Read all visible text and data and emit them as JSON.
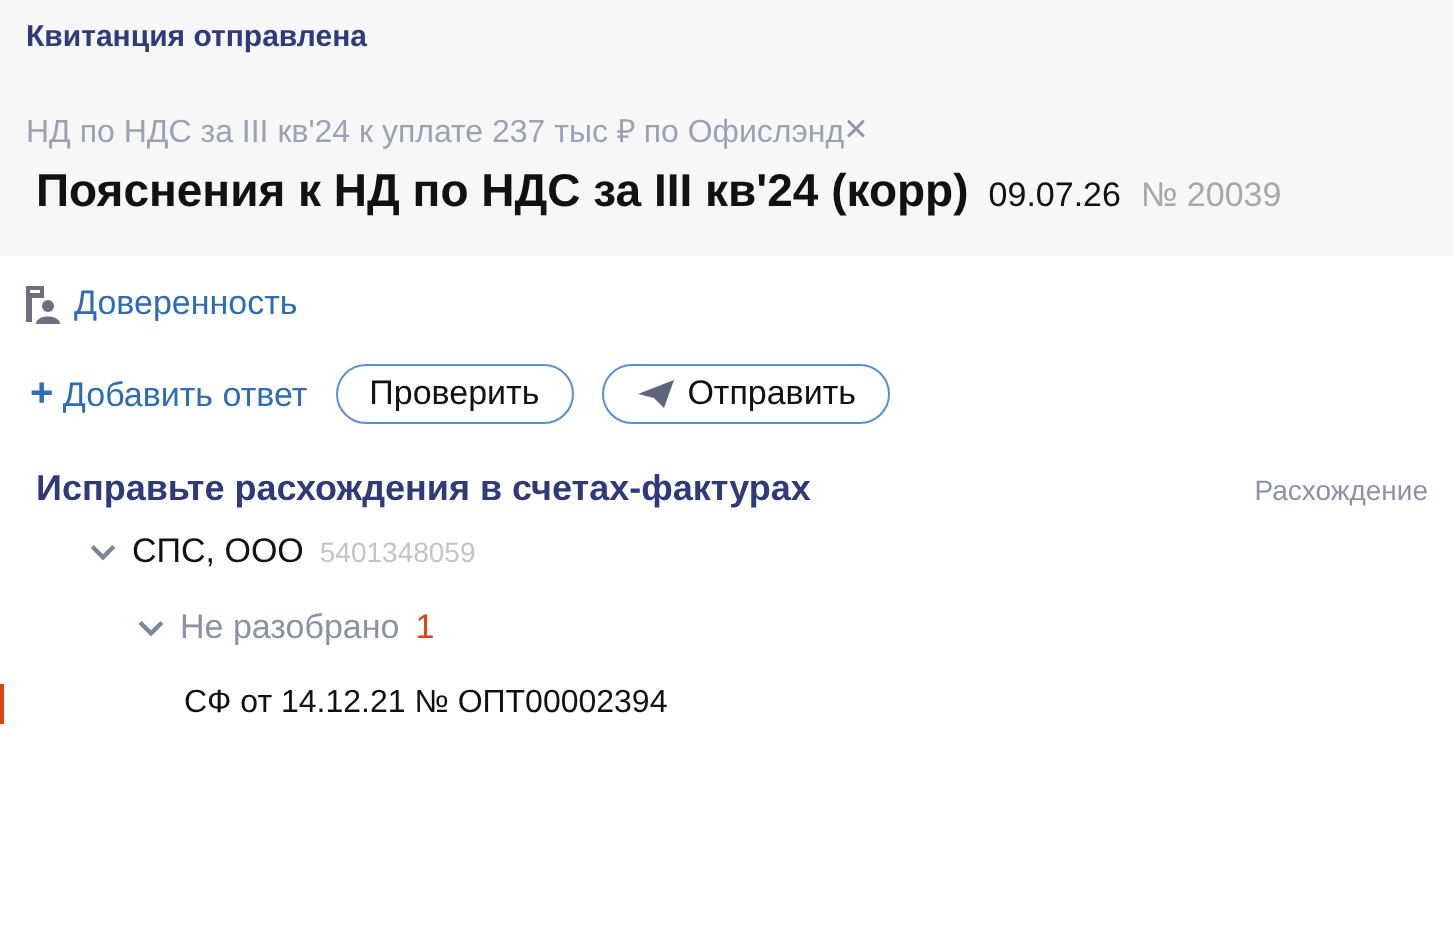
{
  "header": {
    "status": "Квитанция отправлена",
    "subtitle": "НД по НДС за III кв'24 к уплате 237 тыс ₽ по Офислэнд",
    "close_icon": "×",
    "title": "Пояснения к НД по НДС за III кв'24 (корр)",
    "date": "09.07.26",
    "number": "№ 20039"
  },
  "power_of_attorney": "Доверенность",
  "actions": {
    "add": "Добавить ответ",
    "add_icon": "+",
    "buttons": [
      {
        "label": "Проверить",
        "kind": "plain"
      },
      {
        "label": "Отправить",
        "kind": "send"
      }
    ]
  },
  "section": {
    "title": "Исправьте расхождения в счетах-фактурах",
    "column": "Расхождение",
    "tree": [
      {
        "name": "СПС, ООО",
        "inn": "5401348059",
        "expanded": true,
        "children": [
          {
            "name": "Не разобрано",
            "count": "1",
            "expanded": true,
            "children": [
              {
                "name": "СФ от 14.12.21 № ОПТ00002394",
                "selected": true
              }
            ]
          }
        ]
      }
    ]
  }
}
